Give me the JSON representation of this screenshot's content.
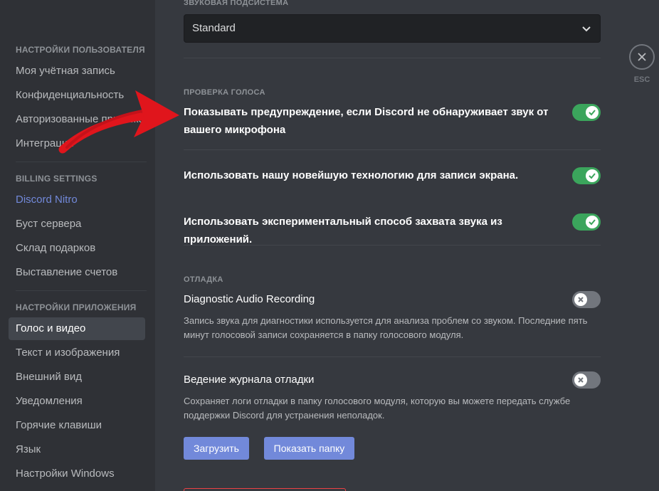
{
  "sidebar": {
    "user_settings_header": "НАСТРОЙКИ ПОЛЬЗОВАТЕЛЯ",
    "user_items": [
      "Моя учётная запись",
      "Конфиденциальность",
      "Авторизованные приложения",
      "Интеграции"
    ],
    "billing_header": "BILLING SETTINGS",
    "billing_items": [
      "Discord Nitro",
      "Буст сервера",
      "Склад подарков",
      "Выставление счетов"
    ],
    "app_settings_header": "НАСТРОЙКИ ПРИЛОЖЕНИЯ",
    "app_items": [
      "Голос и видео",
      "Текст и изображения",
      "Внешний вид",
      "Уведомления",
      "Горячие клавиши",
      "Язык",
      "Настройки Windows"
    ],
    "selected_item": "Голос и видео"
  },
  "audio_subsystem": {
    "label": "ЗВУКОВАЯ ПОДСИСТЕМА",
    "value": "Standard"
  },
  "voice_check": {
    "label": "ПРОВЕРКА ГОЛОСА",
    "rows": [
      {
        "title": "Показывать предупреждение, если Discord не обнаруживает звук от вашего микрофона",
        "enabled": true
      },
      {
        "title": "Использовать нашу новейшую технологию для записи экрана.",
        "enabled": true
      },
      {
        "title": "Использовать экспериментальный способ захвата звука из приложений.",
        "enabled": true
      }
    ]
  },
  "debug": {
    "label": "ОТЛАДКА",
    "diagnostic": {
      "title": "Diagnostic Audio Recording",
      "description": "Запись звука для диагностики используется для анализа проблем со звуком. Последние пять минут голосовой записи сохраняется в папку голосового модуля.",
      "enabled": false
    },
    "logging": {
      "title": "Ведение журнала отладки",
      "description": "Сохраняет логи отладки в папку голосового модуля, которую вы можете передать службе поддержки Discord для устранения неполадок.",
      "enabled": false
    },
    "upload_button": "Загрузить",
    "show_folder_button": "Показать папку"
  },
  "close": {
    "label": "ESC"
  },
  "colors": {
    "accent": "#7289da",
    "toggle_on": "#3ba55c",
    "toggle_off": "#72767d",
    "annotation_arrow": "#e0151c"
  }
}
